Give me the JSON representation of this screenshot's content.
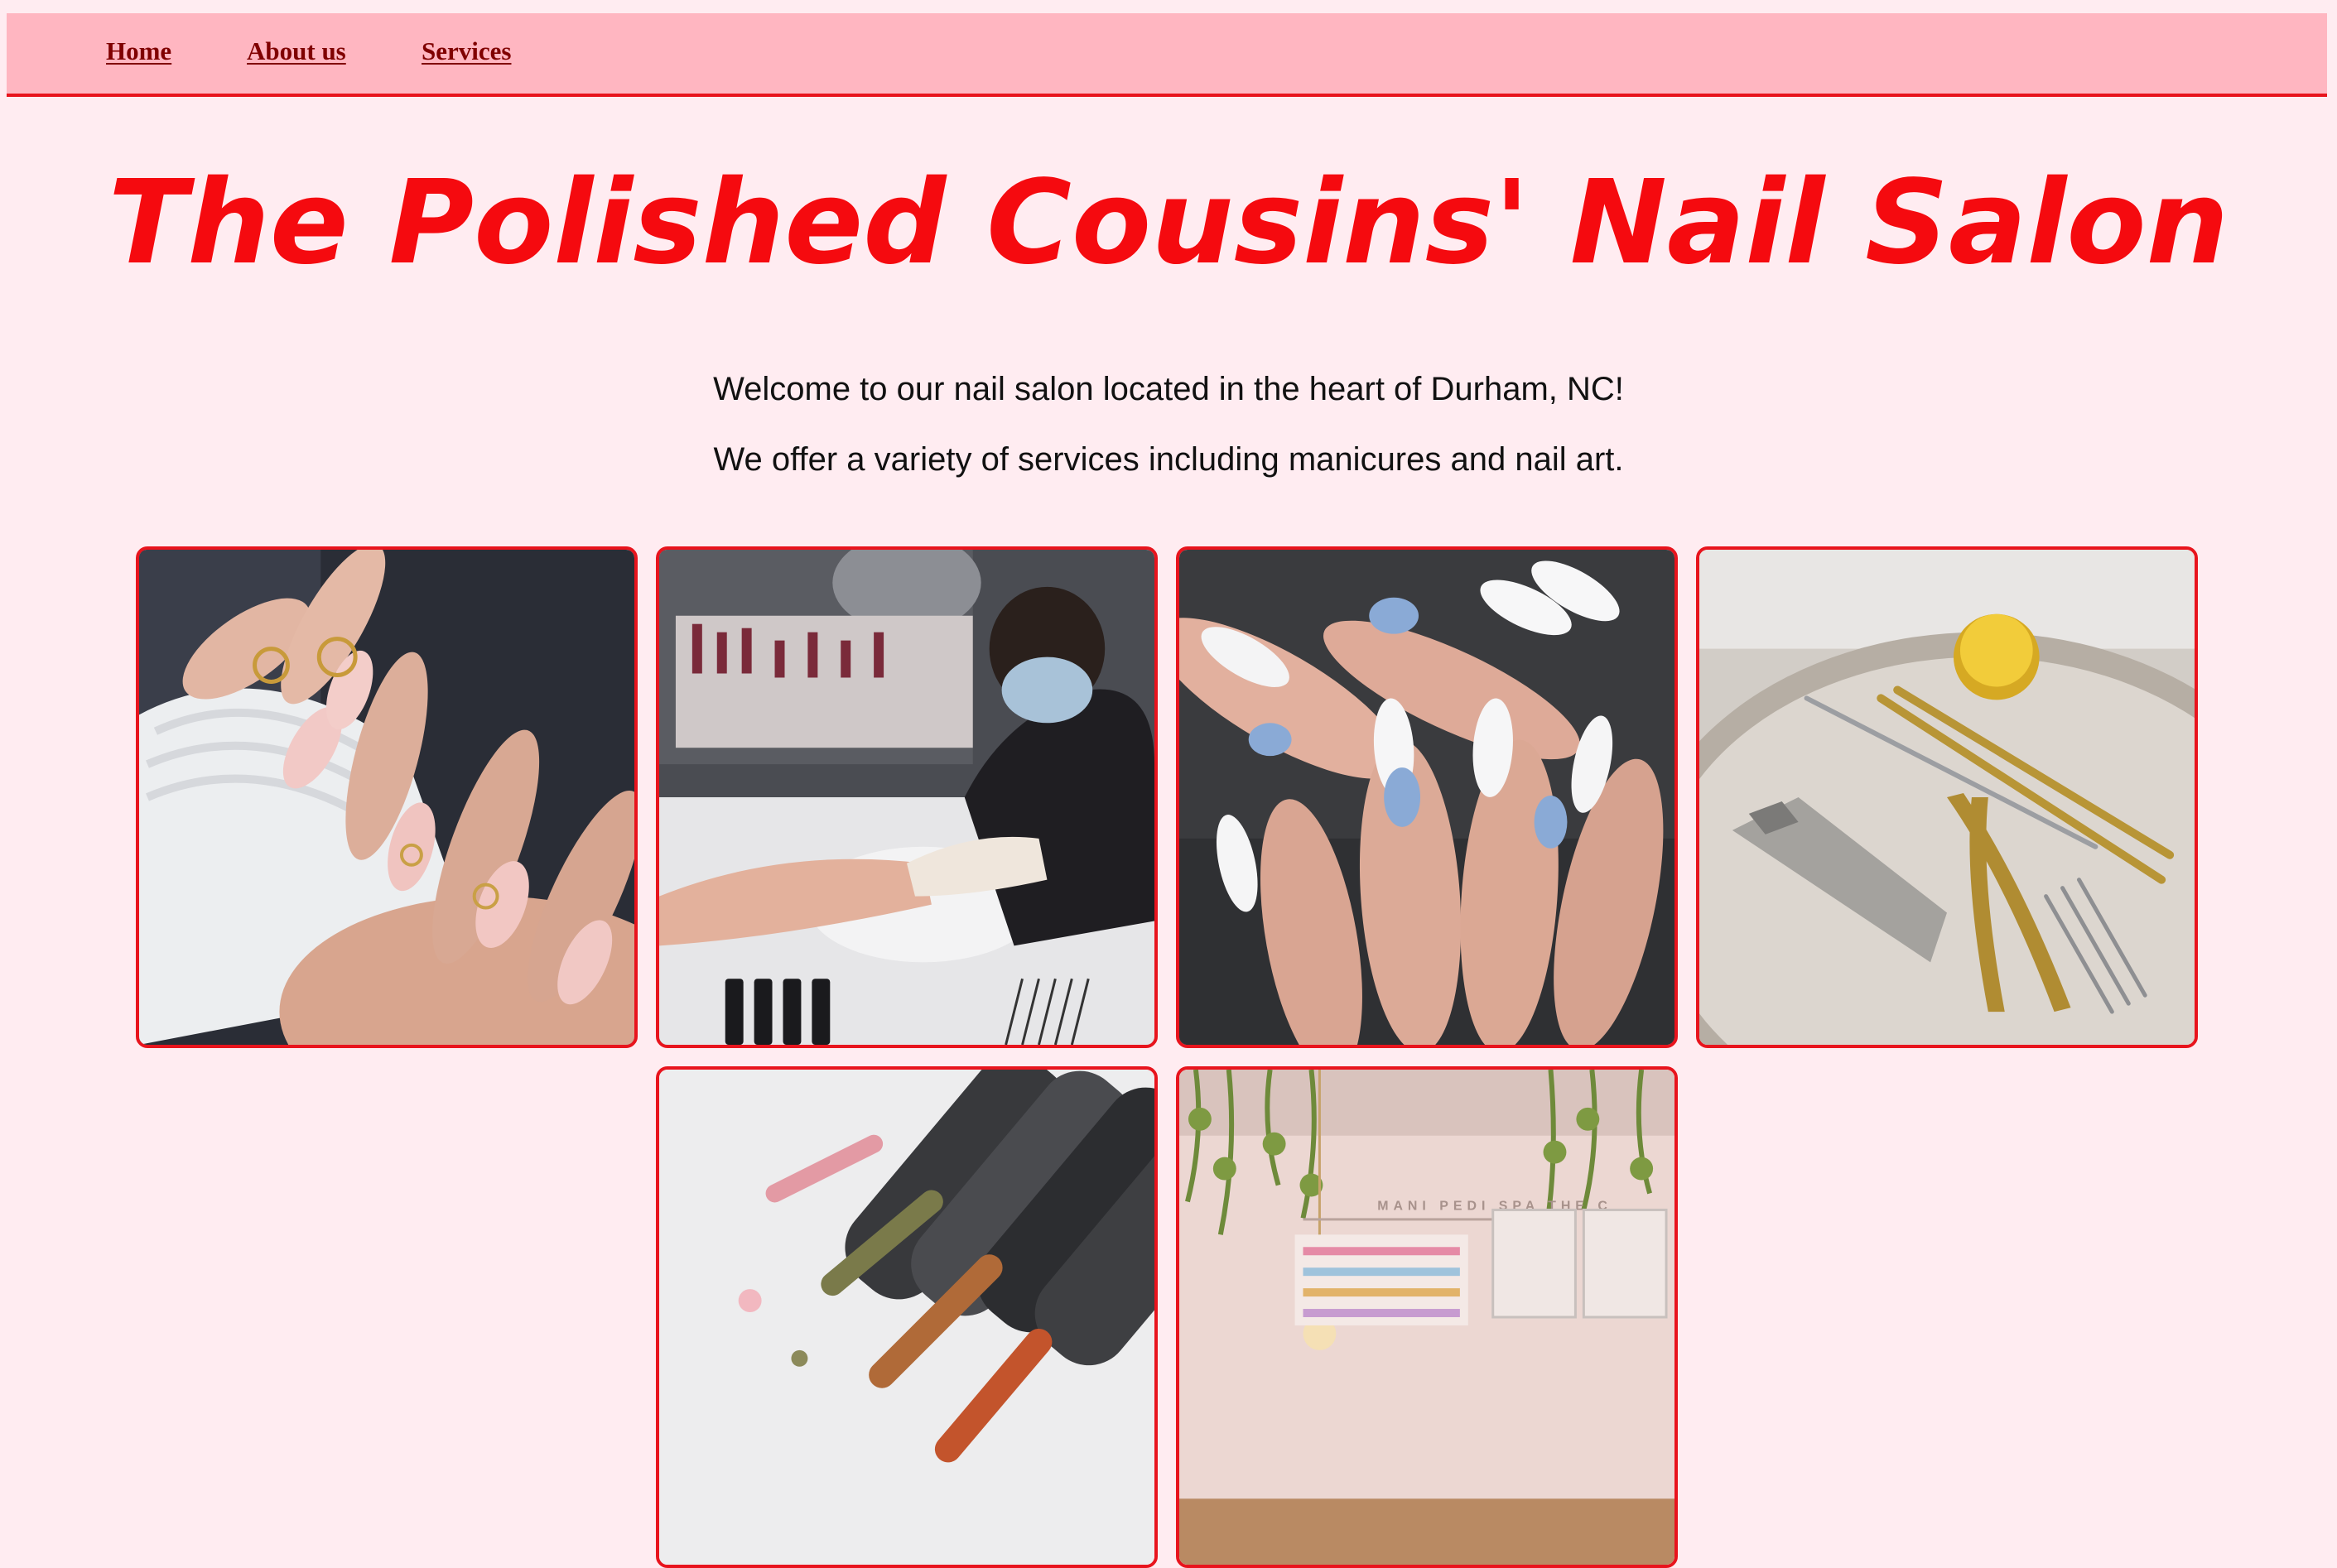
{
  "nav": {
    "home": "Home",
    "about": "About us",
    "services": "Services"
  },
  "header": {
    "title": "The Polished Cousins' Nail Salon"
  },
  "intro": {
    "line1": "Welcome to our nail salon located in the heart of Durham, NC!",
    "line2": "We offer a variety of services including manicures and nail art."
  },
  "gallery": {
    "sign_text": "MANI PEDI SPA  THE C"
  },
  "colors": {
    "background": "#ffecf1",
    "navbar": "#ffb6c1",
    "accent_red": "#e8141d",
    "title_red": "#f50a0f",
    "nav_link": "#800000"
  }
}
